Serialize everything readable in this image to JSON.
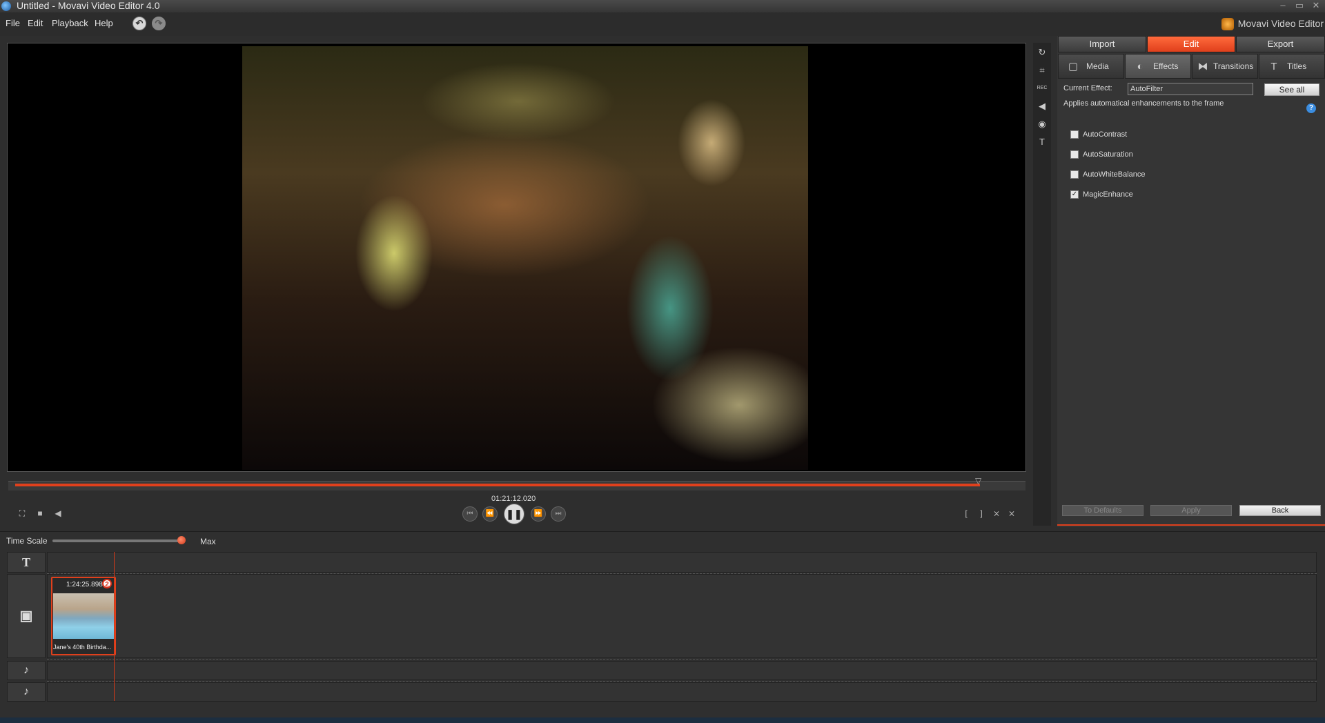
{
  "window": {
    "title": "Untitled - Movavi Video Editor 4.0",
    "controls": {
      "minimize": "–",
      "maximize": "▭",
      "close": "✕"
    }
  },
  "menu": [
    "File",
    "Edit",
    "Playback",
    "Help"
  ],
  "toolbar": {
    "undo_icon": "↶",
    "redo_icon": "↷"
  },
  "brand": {
    "label": "Movavi Video Editor"
  },
  "player": {
    "timecode": "01:21:12.020",
    "progress_fraction": 0.96,
    "controls": {
      "go_start": "⏮",
      "rewind": "⏪",
      "pause": "❚❚",
      "forward": "⏩",
      "go_end": "⏭",
      "fullscreen": "⛶",
      "stop": "■",
      "volume": "◀",
      "mark_in": "[",
      "mark_out": "]",
      "split": "⨯",
      "cut": "⨯"
    }
  },
  "side_tools": [
    "rotate-icon",
    "crop-icon",
    "rec-icon",
    "audio-icon",
    "color-icon",
    "text-icon"
  ],
  "side_tool_glyphs": [
    "↻",
    "⌗",
    "REC",
    "◀",
    "◉",
    "T"
  ],
  "right_panel": {
    "top_tabs": [
      {
        "label": "Import",
        "active": false
      },
      {
        "label": "Edit",
        "active": true
      },
      {
        "label": "Export",
        "active": false
      }
    ],
    "sub_tabs": [
      {
        "label": "Media",
        "icon": "▢",
        "active": false
      },
      {
        "label": "Effects",
        "icon": "◐",
        "active": true
      },
      {
        "label": "Transitions",
        "icon": "⧓",
        "active": false
      },
      {
        "label": "Titles",
        "icon": "T",
        "active": false
      }
    ],
    "current_effect_label": "Current Effect:",
    "current_effect_value": "AutoFilter",
    "see_all": "See all",
    "description": "Applies automatical enhancements to the frame",
    "help": "?",
    "options": [
      {
        "label": "AutoContrast",
        "checked": false
      },
      {
        "label": "AutoSaturation",
        "checked": false
      },
      {
        "label": "AutoWhiteBalance",
        "checked": false
      },
      {
        "label": "MagicEnhance",
        "checked": true
      }
    ],
    "buttons": {
      "defaults": "To Defaults",
      "apply": "Apply",
      "back": "Back"
    }
  },
  "timeline": {
    "time_scale_label": "Time Scale",
    "time_scale_max": "Max",
    "track_icons": {
      "title": "T",
      "video": "▣",
      "audio1": "♪",
      "audio2": "♪"
    },
    "clip": {
      "duration": "1:24:25.898",
      "badge": "2",
      "name": "Jane's 40th Birthda..."
    }
  }
}
